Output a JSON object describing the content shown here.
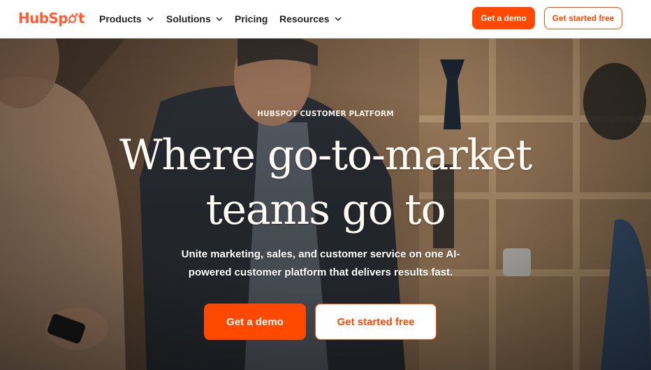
{
  "brand": {
    "logo_prefix": "HubSp",
    "logo_suffix": "t",
    "accent_color": "#ff4800"
  },
  "nav": {
    "items": [
      {
        "label": "Products",
        "has_dropdown": true,
        "icon": "chevron-down-icon"
      },
      {
        "label": "Solutions",
        "has_dropdown": true,
        "icon": "chevron-down-icon"
      },
      {
        "label": "Pricing",
        "has_dropdown": false
      },
      {
        "label": "Resources",
        "has_dropdown": true,
        "icon": "chevron-down-icon"
      }
    ],
    "demo_label": "Get a demo",
    "free_label": "Get started free"
  },
  "hero": {
    "eyebrow": "HUBSPOT CUSTOMER PLATFORM",
    "headline_line1": "Where go-to-market",
    "headline_line2": "teams go to",
    "subtext": "Unite marketing, sales, and customer service on one AI-powered customer platform that delivers results fast.",
    "demo_label": "Get a demo",
    "free_label": "Get started free",
    "background_image": "office-people-photo"
  }
}
